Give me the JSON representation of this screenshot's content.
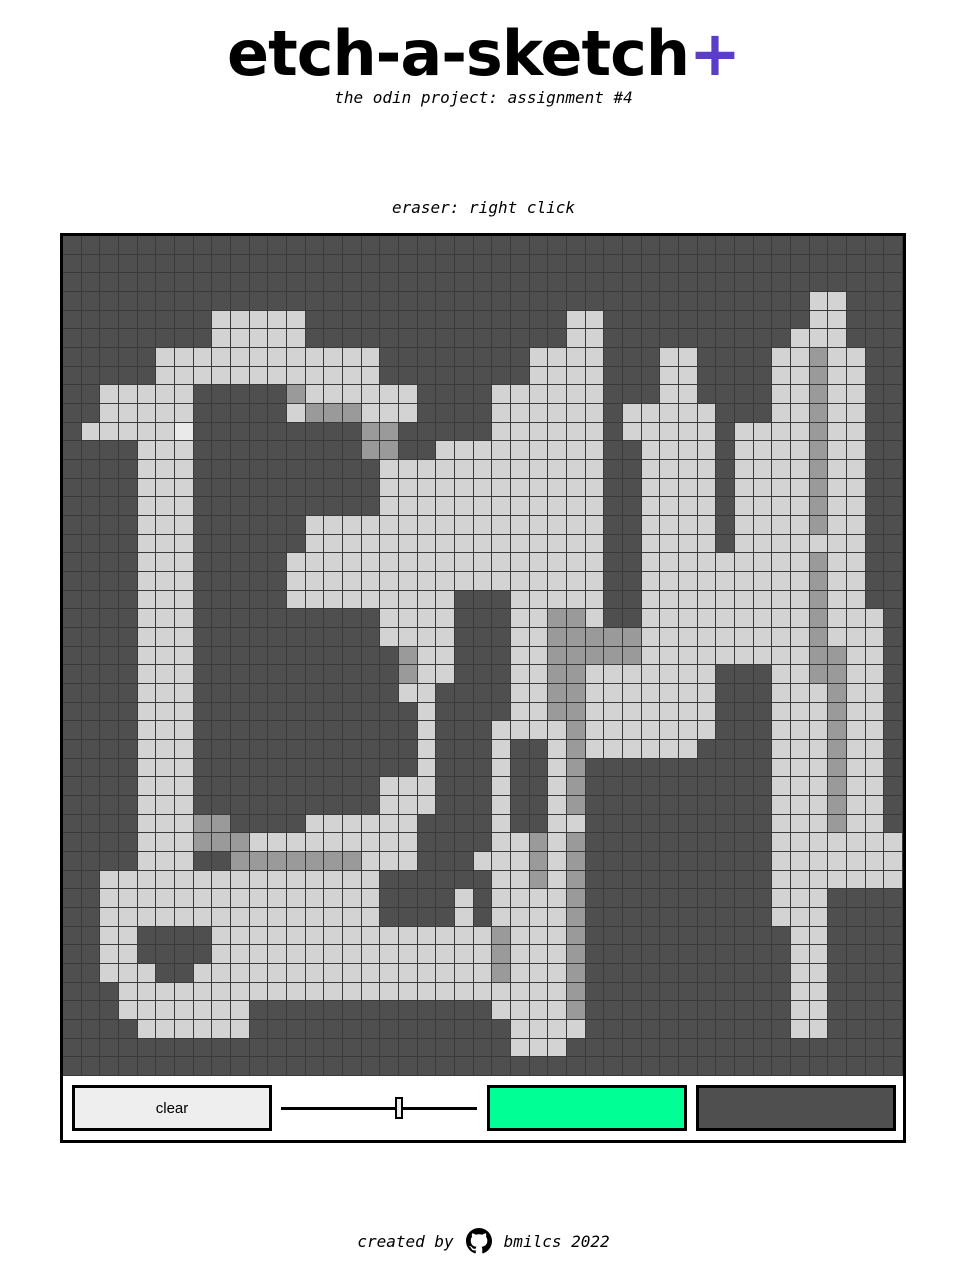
{
  "header": {
    "title": "etch-a-sketch",
    "title_plus": "+",
    "subtitle": "the odin project: assignment #4"
  },
  "hint": "eraser: right click",
  "board": {
    "grid_size": 45,
    "background_color": "#4f4f4f",
    "light_color": "#d3d3d3",
    "mid_color": "#9a9a9a"
  },
  "controls": {
    "clear_label": "clear",
    "grid_slider_fraction": 0.6,
    "pen_color": "#00ff94",
    "background_color": "#4f4f4f"
  },
  "footer": {
    "created_by": "created by",
    "github_icon": "github-icon",
    "author": "bmilcs 2022"
  },
  "colors": {
    "accent": "#5b3ec8"
  }
}
